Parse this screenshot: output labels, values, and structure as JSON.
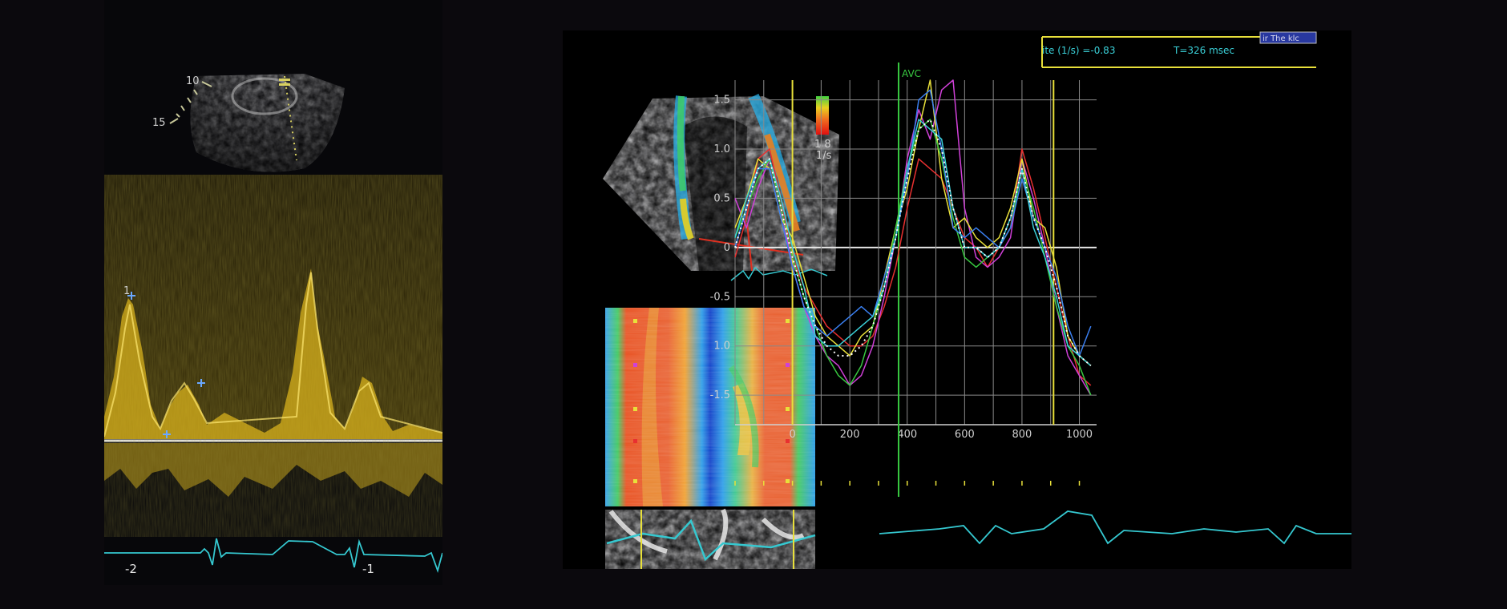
{
  "left_doppler": {
    "depth_labels": [
      "10",
      "15"
    ],
    "time_labels": [
      "-2",
      "-1"
    ],
    "marker_label": "1"
  },
  "strain_rate_plot": {
    "header": {
      "rate_text": "ite (1/s) =-0.83",
      "time_text": "T=326 msec",
      "button_label": "ir The klc"
    },
    "event_label": "AVC",
    "colorbar_labels": [
      "1 8",
      "1/s"
    ],
    "colors": {
      "accent_yellow": "#e8e03a",
      "event_green": "#38c840",
      "grid": "#8a8a8a",
      "ecg": "#35c8d0"
    }
  },
  "chart_data": {
    "type": "line",
    "xlabel": "",
    "ylabel": "",
    "x_ticks": [
      "0",
      "200",
      "400",
      "600",
      "800",
      "1000"
    ],
    "y_ticks": [
      "1.5",
      "1.0",
      "0.5",
      "0",
      "-0.5",
      "1.0",
      "-1.5"
    ],
    "xlim": [
      -200,
      1060
    ],
    "ylim": [
      -1.8,
      1.7
    ],
    "grid": true,
    "event_lines": {
      "yellow_left": 0,
      "avc": 370,
      "yellow_right": 910
    },
    "x": [
      -200,
      -160,
      -120,
      -80,
      -40,
      0,
      40,
      80,
      120,
      160,
      200,
      240,
      280,
      320,
      360,
      400,
      440,
      480,
      520,
      560,
      600,
      640,
      680,
      720,
      760,
      800,
      840,
      880,
      920,
      960,
      1000,
      1040
    ],
    "series": [
      {
        "color": "#e83030",
        "values": [
          -0.1,
          0.3,
          0.9,
          1.0,
          0.5,
          -0.1,
          -0.4,
          -0.6,
          -0.8,
          -0.9,
          -1.0,
          -1.0,
          -0.9,
          -0.6,
          -0.2,
          0.4,
          0.9,
          0.8,
          0.7,
          0.4,
          0.1,
          0.0,
          -0.2,
          0.0,
          0.2,
          1.0,
          0.6,
          0.1,
          -0.4,
          -0.9,
          -1.3,
          -1.4
        ]
      },
      {
        "color": "#d040d8",
        "values": [
          0.5,
          0.2,
          0.6,
          0.9,
          0.4,
          -0.2,
          -0.6,
          -0.9,
          -1.1,
          -1.2,
          -1.4,
          -1.3,
          -1.0,
          -0.5,
          0.1,
          0.9,
          1.4,
          1.1,
          1.6,
          1.7,
          0.4,
          -0.1,
          -0.2,
          -0.1,
          0.1,
          0.9,
          0.5,
          0.0,
          -0.6,
          -1.1,
          -1.3,
          -1.5
        ]
      },
      {
        "color": "#e8e03a",
        "values": [
          0.2,
          0.5,
          0.9,
          0.8,
          0.3,
          0.1,
          -0.3,
          -0.7,
          -0.9,
          -1.0,
          -1.1,
          -0.9,
          -0.8,
          -0.3,
          0.2,
          0.6,
          1.2,
          1.7,
          0.7,
          0.2,
          0.3,
          0.1,
          0.0,
          0.1,
          0.4,
          0.9,
          0.3,
          0.2,
          -0.2,
          -0.9,
          -1.1,
          -1.2
        ]
      },
      {
        "color": "#38c840",
        "values": [
          0.1,
          0.4,
          0.7,
          0.9,
          0.4,
          -0.1,
          -0.5,
          -0.8,
          -1.1,
          -1.3,
          -1.4,
          -1.2,
          -0.8,
          -0.4,
          0.2,
          0.8,
          1.2,
          1.3,
          0.9,
          0.3,
          -0.1,
          -0.2,
          -0.1,
          0.0,
          0.2,
          0.8,
          0.4,
          -0.1,
          -0.6,
          -1.0,
          -1.2,
          -1.5
        ]
      },
      {
        "color": "#3a7ff0",
        "values": [
          0.0,
          0.4,
          0.8,
          0.8,
          0.3,
          -0.2,
          -0.6,
          -0.8,
          -0.9,
          -0.8,
          -0.7,
          -0.6,
          -0.7,
          -0.3,
          0.1,
          0.7,
          1.5,
          1.6,
          1.0,
          0.2,
          0.1,
          0.2,
          0.1,
          0.0,
          0.2,
          0.7,
          0.3,
          0.0,
          -0.3,
          -0.8,
          -1.1,
          -0.8
        ]
      },
      {
        "color": "#3ad0d8",
        "values": [
          0.1,
          0.5,
          0.8,
          0.9,
          0.5,
          0.0,
          -0.4,
          -0.9,
          -1.0,
          -1.0,
          -0.9,
          -0.8,
          -0.7,
          -0.4,
          0.1,
          0.8,
          1.3,
          1.2,
          1.1,
          0.4,
          0.0,
          0.0,
          -0.1,
          0.0,
          0.3,
          0.8,
          0.2,
          -0.1,
          -0.5,
          -1.0,
          -1.1,
          -1.2
        ]
      },
      {
        "color": "#ffffff",
        "values": [
          0.0,
          0.4,
          0.8,
          0.9,
          0.4,
          -0.1,
          -0.5,
          -0.8,
          -1.0,
          -1.1,
          -1.1,
          -1.0,
          -0.8,
          -0.4,
          0.1,
          0.7,
          1.2,
          1.3,
          1.0,
          0.4,
          0.0,
          0.0,
          -0.1,
          0.0,
          0.3,
          0.8,
          0.3,
          0.0,
          -0.4,
          -0.9,
          -1.1,
          -1.2
        ]
      }
    ]
  }
}
